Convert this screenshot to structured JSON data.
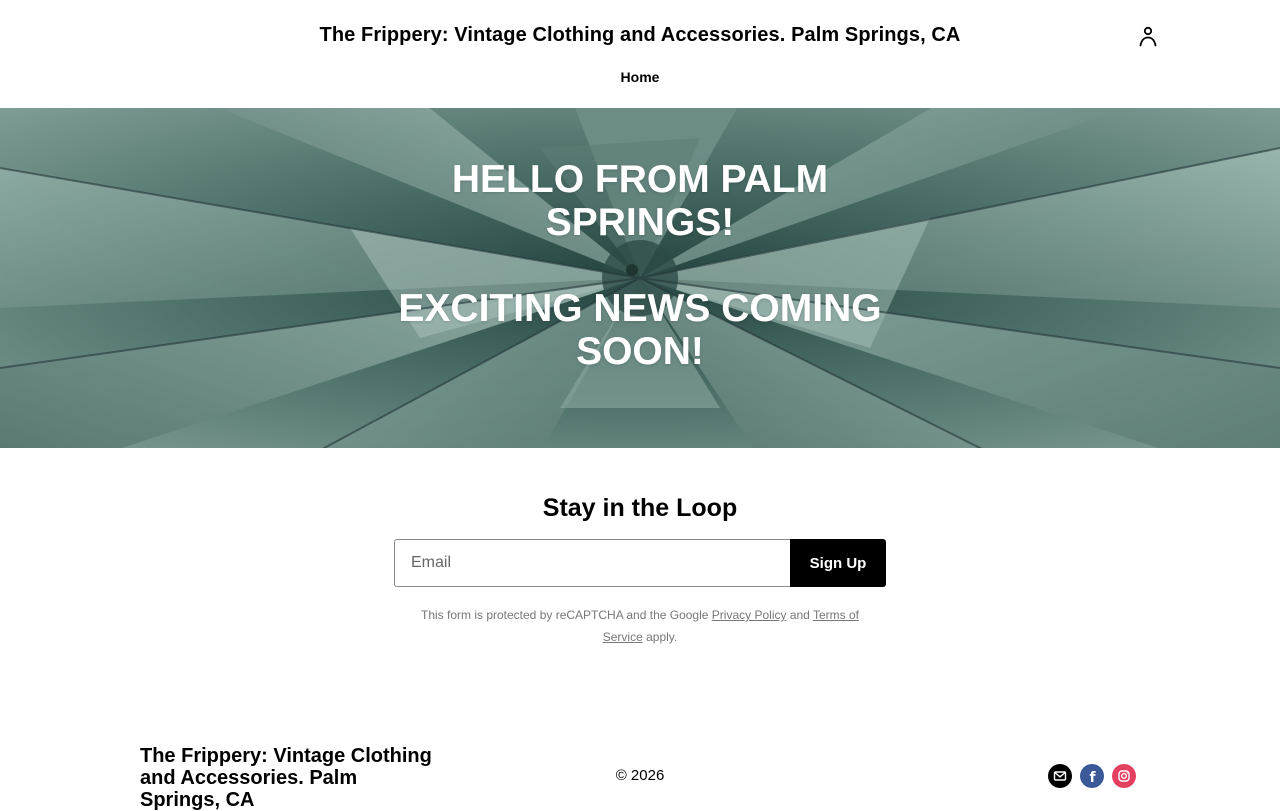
{
  "header": {
    "site_title": "The Frippery: Vintage Clothing and Accessories. Palm Springs, CA",
    "nav": [
      {
        "label": "Home"
      }
    ],
    "account_icon": "person-icon"
  },
  "hero": {
    "line1": "HELLO FROM PALM",
    "line2": "SPRINGS!",
    "line3": "EXCITING NEWS COMING",
    "line4": "SOON!",
    "background": "agave-plant-photo"
  },
  "newsletter": {
    "title": "Stay in the Loop",
    "email_placeholder": "Email",
    "email_value": "",
    "signup_label": "Sign Up",
    "note_prefix": "This form is protected by reCAPTCHA and the Google",
    "privacy_link": "Privacy Policy",
    "note_and": "and",
    "terms_link": "Terms of Service",
    "note_suffix": "apply."
  },
  "footer": {
    "site_title": "The Frippery: Vintage Clothing and Accessories. Palm Springs, CA",
    "copyright": "© 2026",
    "social": [
      {
        "icon": "email-icon",
        "color": "#000000"
      },
      {
        "icon": "facebook-icon",
        "color": "#3b5998"
      },
      {
        "icon": "instagram-icon",
        "color": "#e4405f"
      }
    ]
  }
}
